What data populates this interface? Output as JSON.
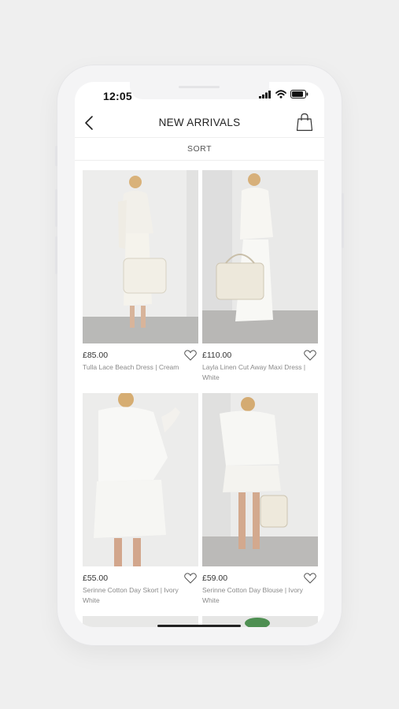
{
  "status_bar": {
    "time": "12:05"
  },
  "header": {
    "title": "NEW ARRIVALS",
    "back_icon": "back-chevron-icon",
    "cart_icon": "shopping-bag-icon"
  },
  "sort": {
    "label": "SORT"
  },
  "products": [
    {
      "price": "£85.00",
      "name": "Tulla Lace Beach Dress | Cream"
    },
    {
      "price": "£110.00",
      "name": "Layla Linen Cut Away Maxi Dress | White"
    },
    {
      "price": "£55.00",
      "name": "Serinne Cotton Day Skort | Ivory White"
    },
    {
      "price": "£59.00",
      "name": "Serinne Cotton Day Blouse | Ivory White"
    }
  ],
  "colors": {
    "background": "#efefef",
    "screen": "#ffffff",
    "text": "#222222",
    "muted": "#8a8a8a"
  }
}
